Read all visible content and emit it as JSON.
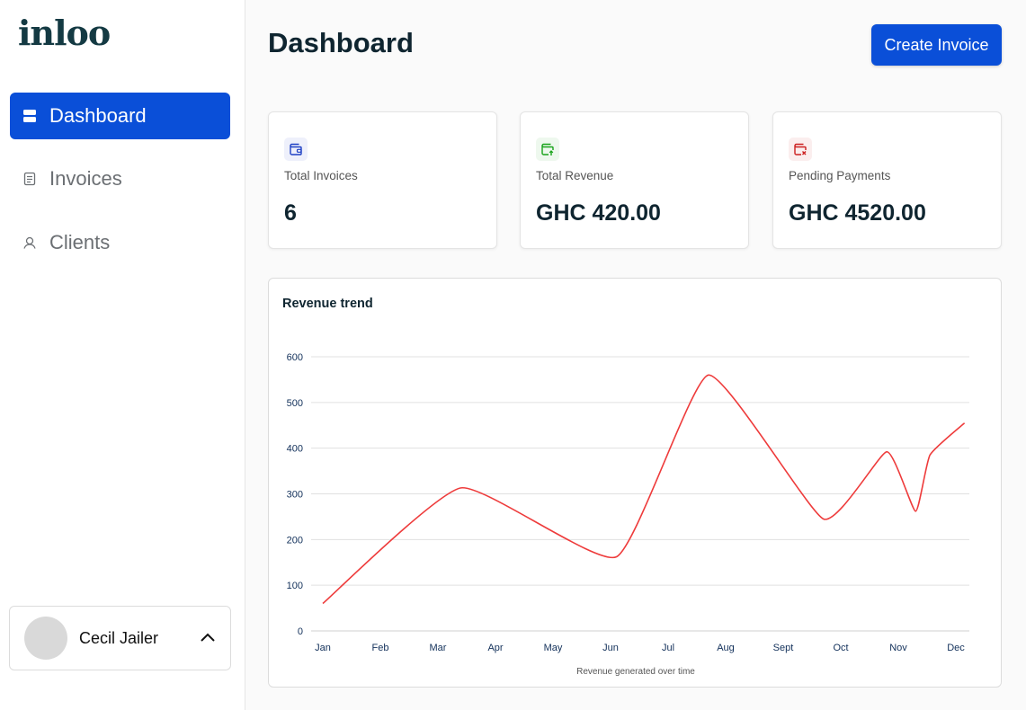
{
  "app": {
    "logo": "inloo"
  },
  "sidebar": {
    "items": [
      {
        "label": "Dashboard",
        "icon": "dashboard-icon",
        "active": true
      },
      {
        "label": "Invoices",
        "icon": "invoice-icon",
        "active": false
      },
      {
        "label": "Clients",
        "icon": "clients-icon",
        "active": false
      }
    ],
    "user": {
      "name": "Cecil Jailer"
    }
  },
  "header": {
    "title": "Dashboard",
    "create_label": "Create Invoice"
  },
  "stats": [
    {
      "label": "Total Invoices",
      "value": "6",
      "icon": "wallet-icon",
      "color": "#1d3fc4",
      "bg": "#eef0fb"
    },
    {
      "label": "Total Revenue",
      "value": "GHC 420.00",
      "icon": "wallet-check-icon",
      "color": "#18a31a",
      "bg": "#eef8ee"
    },
    {
      "label": "Pending Payments",
      "value": "GHC 4520.00",
      "icon": "wallet-alert-icon",
      "color": "#cc1f1f",
      "bg": "#fbeeee"
    }
  ],
  "colors": {
    "accent": "#0a4fd8",
    "line": "#ee3b3b"
  },
  "chart_data": {
    "type": "line",
    "title": "Revenue trend",
    "xlabel": "Revenue generated over time",
    "categories": [
      "Jan",
      "Feb",
      "Mar",
      "Apr",
      "May",
      "Jun",
      "Jul",
      "Aug",
      "Sept",
      "Oct",
      "Nov",
      "Dec"
    ],
    "ylim": [
      0,
      600
    ],
    "yticks": [
      0,
      100,
      200,
      300,
      400,
      500,
      600
    ],
    "grid": true,
    "points": [
      {
        "x": 0,
        "y": 60
      },
      {
        "x": 2.4,
        "y": 313
      },
      {
        "x": 5.1,
        "y": 162
      },
      {
        "x": 6.7,
        "y": 560
      },
      {
        "x": 8.7,
        "y": 245
      },
      {
        "x": 9.8,
        "y": 392
      },
      {
        "x": 10.3,
        "y": 262
      },
      {
        "x": 10.55,
        "y": 385
      },
      {
        "x": 11.15,
        "y": 455
      }
    ]
  }
}
